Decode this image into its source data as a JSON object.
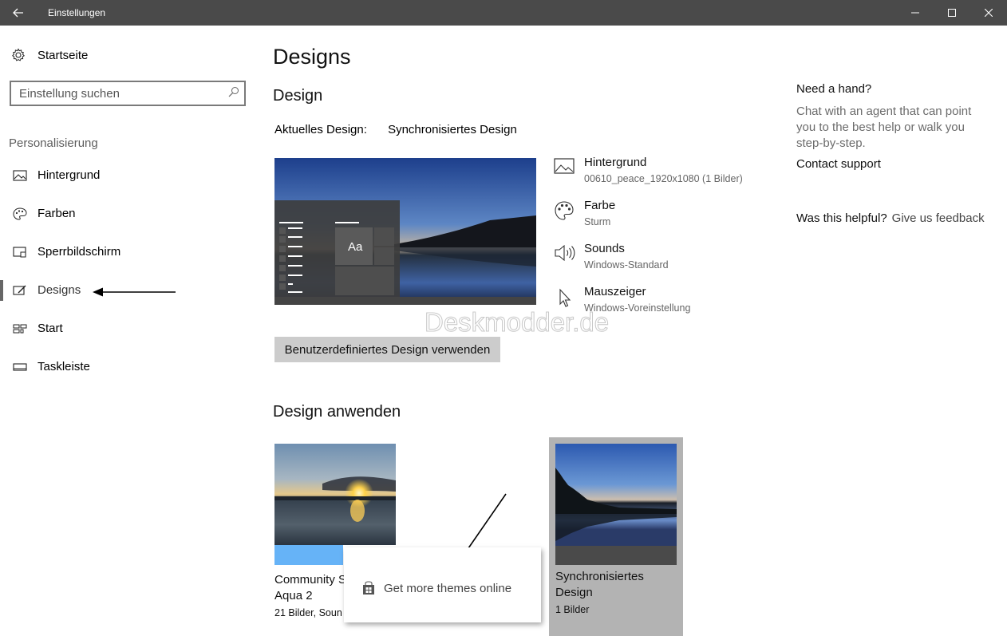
{
  "window": {
    "title": "Einstellungen",
    "back_icon": "arrow-left-icon",
    "minimize_icon": "minimize-icon",
    "maximize_icon": "maximize-icon",
    "close_icon": "close-icon"
  },
  "sidebar": {
    "home_label": "Startseite",
    "search_placeholder": "Einstellung suchen",
    "section": "Personalisierung",
    "items": [
      {
        "label": "Hintergrund",
        "icon": "picture-icon"
      },
      {
        "label": "Farben",
        "icon": "palette-icon"
      },
      {
        "label": "Sperrbildschirm",
        "icon": "lock-screen-icon"
      },
      {
        "label": "Designs",
        "icon": "brush-icon",
        "active": true
      },
      {
        "label": "Start",
        "icon": "start-icon"
      },
      {
        "label": "Taskleiste",
        "icon": "taskbar-icon"
      }
    ]
  },
  "main": {
    "page_title": "Designs",
    "design_heading": "Design",
    "current_label": "Aktuelles Design:",
    "current_value": "Synchronisiertes Design",
    "preview_sample_text": "Aa",
    "properties": [
      {
        "title": "Hintergrund",
        "subtitle": "00610_peace_1920x1080 (1 Bilder)",
        "icon": "picture-icon"
      },
      {
        "title": "Farbe",
        "subtitle": "Sturm",
        "icon": "palette-icon"
      },
      {
        "title": "Sounds",
        "subtitle": "Windows-Standard",
        "icon": "speaker-icon"
      },
      {
        "title": "Mauszeiger",
        "subtitle": "Windows-Voreinstellung",
        "icon": "cursor-icon"
      }
    ],
    "custom_button": "Benutzerdefiniertes Design verwenden",
    "watermark": "Deskmodder.de",
    "apply_heading": "Design anwenden",
    "themes": [
      {
        "name_line1": "Community S",
        "name_line2": "Aqua 2",
        "subtitle": "21 Bilder, Soun"
      },
      {
        "name_line1": "Synchronisiertes",
        "name_line2": "Design",
        "subtitle": "1 Bilder"
      }
    ],
    "popup_item": "Get more themes online",
    "popup_icon": "store-icon"
  },
  "help": {
    "title": "Need a hand?",
    "text": "Chat with an agent that can point you to the best help or walk you step-by-step.",
    "contact": "Contact support",
    "helpful_q": "Was this helpful?",
    "feedback": "Give us feedback"
  },
  "colors": {
    "titlebar": "#4a4a4a",
    "accent_blue": "#5cb3f5",
    "selected_tile": "#b3b3b3"
  }
}
